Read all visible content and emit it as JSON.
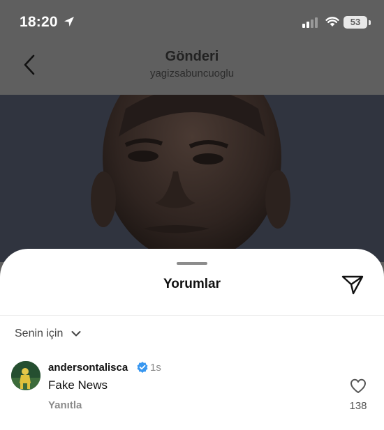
{
  "status_bar": {
    "time": "18:20",
    "battery": "53",
    "icons": [
      "location-arrow-icon",
      "signal-icon",
      "wifi-icon",
      "battery-icon"
    ]
  },
  "header": {
    "title": "Gönderi",
    "subtitle": "yagizsabuncuoglu",
    "back_icon": "chevron-left-icon"
  },
  "comments_sheet": {
    "title": "Yorumlar",
    "send_icon": "paper-plane-icon",
    "filter_label": "Senin için",
    "filter_icon": "chevron-down-icon",
    "comment": {
      "username": "andersontalisca",
      "verified": true,
      "time_ago": "1s",
      "text": "Fake News",
      "reply_label": "Yanıtla",
      "likes": "138"
    }
  },
  "colors": {
    "overlay": "#5f5f5f",
    "sheet": "#ffffff",
    "verified": "#3897f0",
    "muted_text": "#8a8a8a"
  }
}
